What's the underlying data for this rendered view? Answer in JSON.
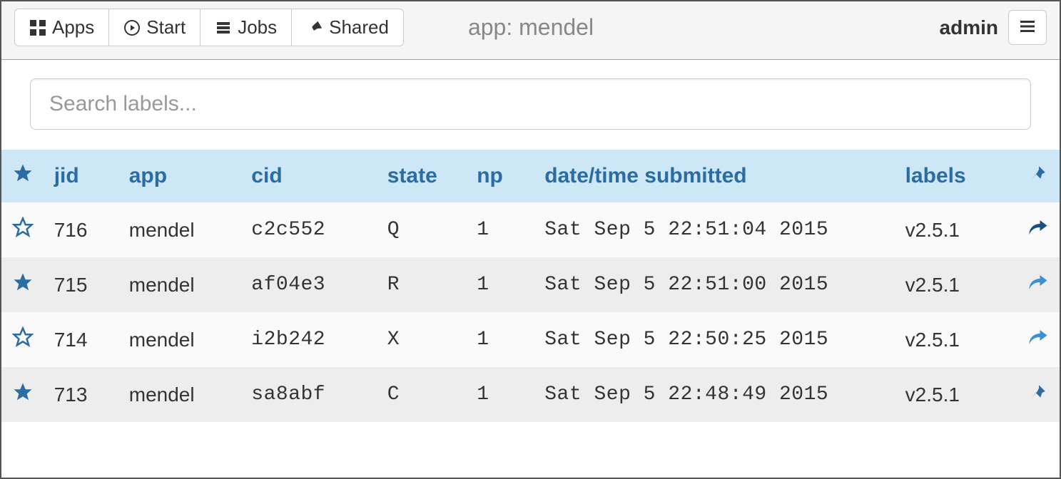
{
  "nav": {
    "apps": "Apps",
    "start": "Start",
    "jobs": "Jobs",
    "shared": "Shared"
  },
  "header": {
    "app_prefix": "app: ",
    "app_name": "mendel",
    "user": "admin"
  },
  "search": {
    "placeholder": "Search labels..."
  },
  "columns": {
    "jid": "jid",
    "app": "app",
    "cid": "cid",
    "state": "state",
    "np": "np",
    "datetime": "date/time submitted",
    "labels": "labels"
  },
  "rows": [
    {
      "starred": false,
      "jid": "716",
      "app": "mendel",
      "cid": "c2c552",
      "state": "Q",
      "np": "1",
      "datetime": "Sat Sep 5 22:51:04 2015",
      "labels": "v2.5.1",
      "action": "share"
    },
    {
      "starred": true,
      "jid": "715",
      "app": "mendel",
      "cid": "af04e3",
      "state": "R",
      "np": "1",
      "datetime": "Sat Sep 5 22:51:00 2015",
      "labels": "v2.5.1",
      "action": "share-light"
    },
    {
      "starred": false,
      "jid": "714",
      "app": "mendel",
      "cid": "i2b242",
      "state": "X",
      "np": "1",
      "datetime": "Sat Sep 5 22:50:25 2015",
      "labels": "v2.5.1",
      "action": "share-light"
    },
    {
      "starred": true,
      "jid": "713",
      "app": "mendel",
      "cid": "sa8abf",
      "state": "C",
      "np": "1",
      "datetime": "Sat Sep 5 22:48:49 2015",
      "labels": "v2.5.1",
      "action": "pin"
    }
  ]
}
